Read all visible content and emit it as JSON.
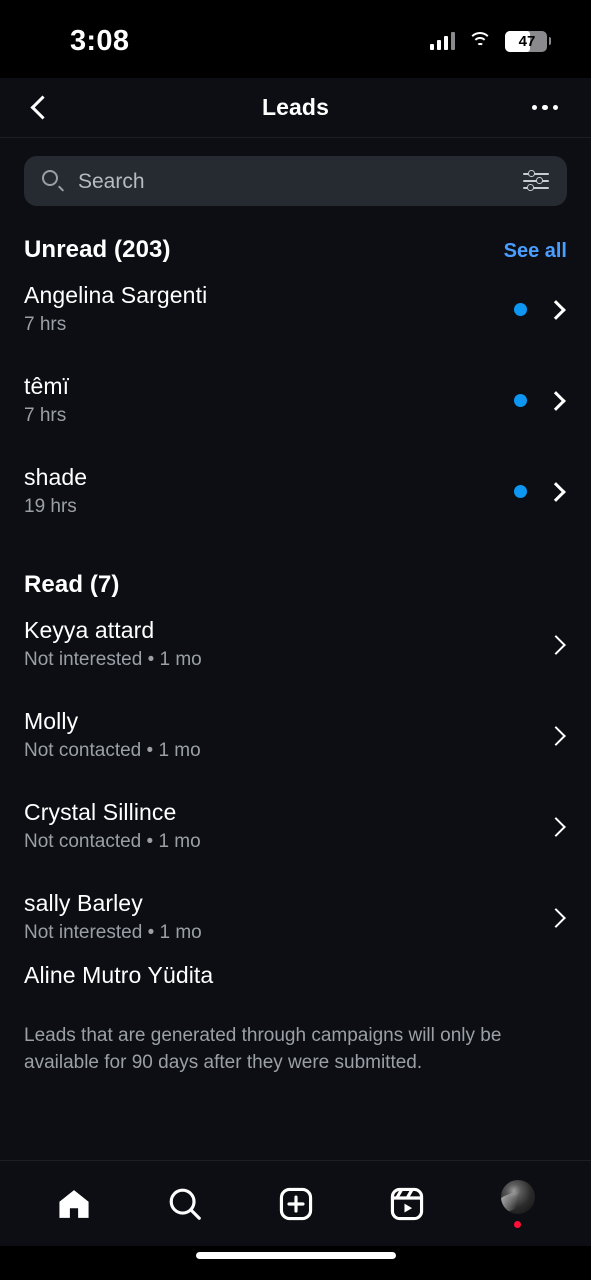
{
  "status_bar": {
    "time": "3:08",
    "battery_level": "47",
    "signal_icon": "cellular-signal-icon",
    "wifi_icon": "wifi-icon",
    "battery_icon": "battery-icon"
  },
  "header": {
    "title": "Leads",
    "back_icon": "back-chevron-icon",
    "more_icon": "more-options-icon"
  },
  "search": {
    "placeholder": "Search",
    "search_icon": "search-icon",
    "filter_icon": "filter-sliders-icon"
  },
  "sections": {
    "unread": {
      "title": "Unread (203)",
      "see_all_label": "See all",
      "items": [
        {
          "name": "Angelina Sargenti",
          "meta": "7 hrs"
        },
        {
          "name": "têmï",
          "meta": "7 hrs"
        },
        {
          "name": "shade",
          "meta": "19 hrs"
        }
      ]
    },
    "read": {
      "title": "Read (7)",
      "items": [
        {
          "name": "Keyya attard",
          "meta": "Not interested • 1 mo"
        },
        {
          "name": "Molly",
          "meta": "Not contacted • 1 mo"
        },
        {
          "name": "Crystal Sillince",
          "meta": "Not contacted • 1 mo"
        },
        {
          "name": "sally Barley",
          "meta": "Not interested • 1 mo"
        },
        {
          "name": "Aline Mutro Yüdita",
          "meta": ""
        }
      ]
    }
  },
  "footnote": "Leads that are generated through campaigns will only be available for 90 days after they were submitted.",
  "tab_bar": {
    "tabs": [
      {
        "icon": "home-icon",
        "active": true
      },
      {
        "icon": "search-icon",
        "active": false
      },
      {
        "icon": "create-plus-icon",
        "active": false
      },
      {
        "icon": "reels-icon",
        "active": false
      },
      {
        "icon": "profile-avatar",
        "active": false
      }
    ],
    "has_notification_dot": true
  },
  "colors": {
    "background": "#0c0e13",
    "accent_blue": "#0d96f2",
    "link_blue": "#4a9eff",
    "secondary_text": "#9aa0a6",
    "notification_red": "#ff0f37"
  }
}
